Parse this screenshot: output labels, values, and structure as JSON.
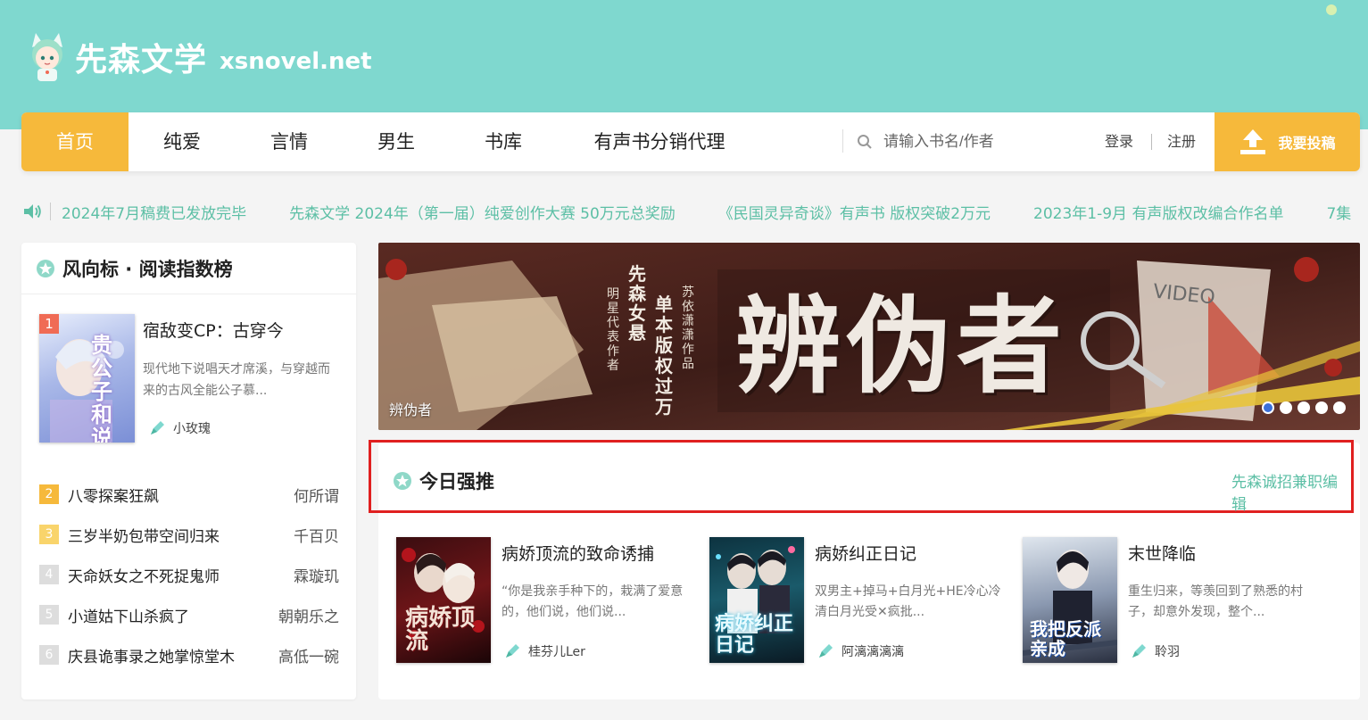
{
  "site": {
    "name_cn": "先森文学",
    "domain": "xsnovel.net"
  },
  "nav": {
    "items": [
      {
        "label": "首页",
        "active": true
      },
      {
        "label": "纯爱",
        "active": false
      },
      {
        "label": "言情",
        "active": false
      },
      {
        "label": "男生",
        "active": false
      },
      {
        "label": "书库",
        "active": false
      },
      {
        "label": "有声书分销代理",
        "active": false
      }
    ],
    "search_placeholder": "请输入书名/作者",
    "login": "登录",
    "register": "注册",
    "submit_label": "我要投稿"
  },
  "notices": [
    "2024年7月稿费已发放完毕",
    "先森文学 2024年（第一届）纯爱创作大赛 50万元总奖励",
    "《民国灵异奇谈》有声书 版权突破2万元",
    "2023年1-9月 有声版权改编合作名单",
    "7集"
  ],
  "ranking": {
    "title": "风向标 · 阅读指数榜",
    "top": {
      "rank": "1",
      "title": "宿敌变CP：古穿今",
      "desc": "现代地下说唱天才席溪，与穿越而来的古风全能公子慕...",
      "author": "小玫瑰",
      "cover_text": "贵公子和说唱手"
    },
    "items": [
      {
        "rank": "2",
        "title": "八零探案狂飙",
        "author": "何所谓"
      },
      {
        "rank": "3",
        "title": "三岁半奶包带空间归来",
        "author": "千百贝"
      },
      {
        "rank": "4",
        "title": "天命妖女之不死捉鬼师",
        "author": "霖璇玑"
      },
      {
        "rank": "5",
        "title": "小道姑下山杀疯了",
        "author": "朝朝乐之"
      },
      {
        "rank": "6",
        "title": "庆县诡事录之她掌惊堂木",
        "author": "高低一碗"
      }
    ]
  },
  "banner": {
    "label": "辨伪者",
    "headline": "辨伪者",
    "side_text_1": "先森女悬",
    "side_text_2": "单本版权过万",
    "side_text_3": "苏依潇潇 作品",
    "side_text_4": "明星代表作者",
    "video_tag": "VIDEO",
    "slide_count": 5
  },
  "recommend": {
    "title": "今日强推",
    "link": "先森诚招兼职编辑",
    "books": [
      {
        "title": "病娇顶流的致命诱捕",
        "desc": "“你是我亲手种下的，栽满了爱意的，他们说，他们说...",
        "author": "桂芬儿Ler",
        "cover_text": "病娇顶流"
      },
      {
        "title": "病娇纠正日记",
        "desc": "双男主+掉马+白月光+HE冷心冷清白月光受✕疯批...",
        "author": "阿漓漓漓漓",
        "cover_text": "病娇纠正日记"
      },
      {
        "title": "末世降临",
        "desc": "重生归来，等羡回到了熟悉的村子，却意外发现，整个...",
        "author": "聆羽",
        "cover_text": "我把反派亲成"
      }
    ]
  },
  "colors": {
    "header_bg": "#7fd8cf",
    "accent_orange": "#f6b93b",
    "accent_green": "#5cbfa5",
    "highlight_red": "#e02020",
    "rank_colors": [
      "#f06b55",
      "#f6b93b",
      "#f9d46b",
      "#dddddd",
      "#dddddd",
      "#dddddd"
    ]
  },
  "icons": {
    "speaker": "speaker-icon",
    "search": "search-icon",
    "upload": "upload-icon",
    "pen": "pen-icon",
    "section": "flower-icon"
  }
}
